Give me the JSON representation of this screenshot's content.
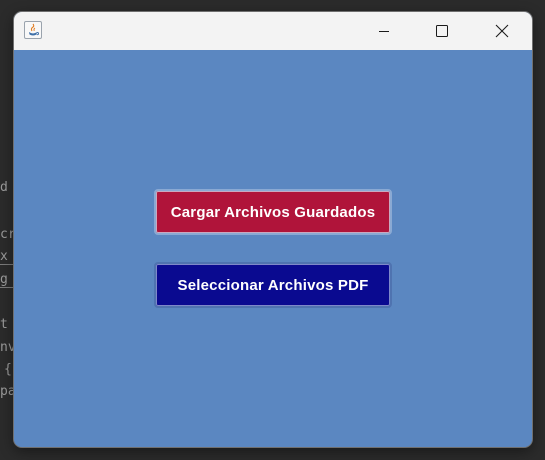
{
  "background_code": {
    "line1": "d",
    "line2": "cr",
    "line3": "x",
    "line4": "g",
    "line5": "t",
    "line6": "nv",
    "line7": "{",
    "line8": "pa"
  },
  "window": {
    "title": "",
    "icon": "java-app-icon",
    "controls": {
      "minimize_icon": "minimize-icon",
      "maximize_icon": "maximize-icon",
      "close_icon": "close-icon"
    },
    "content_background": "#5b87c1"
  },
  "buttons": {
    "load_saved": {
      "label": "Cargar Archivos Guardados",
      "color": "#b0143a"
    },
    "select_pdf": {
      "label": "Seleccionar Archivos PDF",
      "color": "#0a0a90"
    }
  }
}
